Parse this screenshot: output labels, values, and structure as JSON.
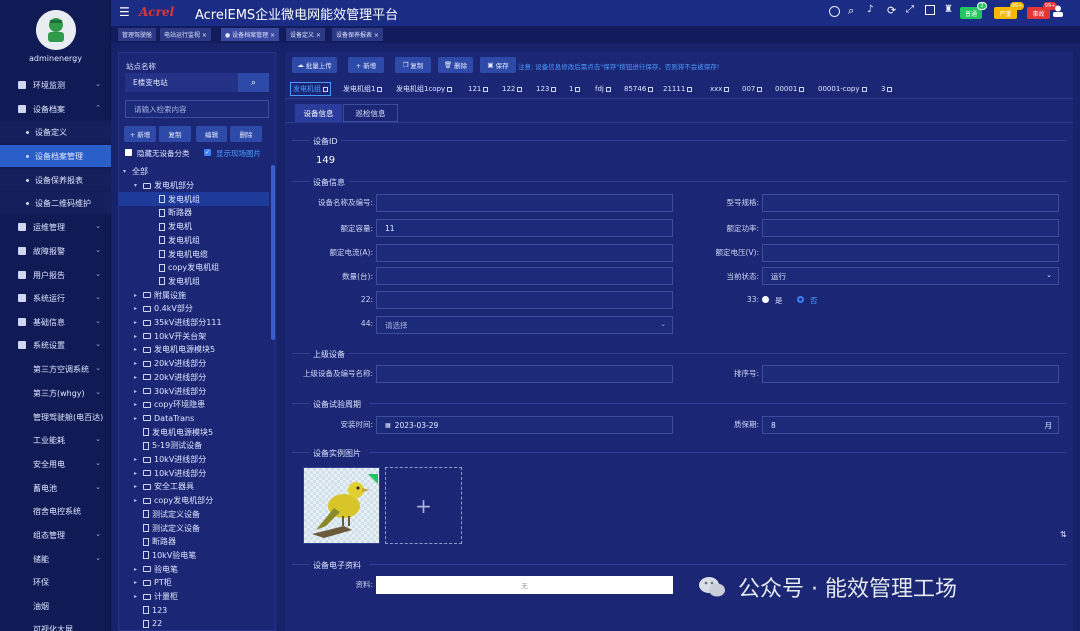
{
  "sidebar": {
    "username": "adminenergy",
    "items": [
      {
        "label": "环境监测"
      },
      {
        "label": "设备档案"
      },
      {
        "label": "设备定义"
      },
      {
        "label": "设备档案管理"
      },
      {
        "label": "设备保养报表"
      },
      {
        "label": "设备二维码维护"
      },
      {
        "label": "运维管理"
      },
      {
        "label": "故障报警"
      },
      {
        "label": "用户报告"
      },
      {
        "label": "系统运行"
      },
      {
        "label": "基础信息"
      },
      {
        "label": "系统设置"
      },
      {
        "label": "第三方空调系统"
      },
      {
        "label": "第三方(whgy)"
      },
      {
        "label": "管理驾驶舱(电百达)"
      },
      {
        "label": "工业能耗"
      },
      {
        "label": "安全用电"
      },
      {
        "label": "蓄电池"
      },
      {
        "label": "宿舍电控系统"
      },
      {
        "label": "组态管理"
      },
      {
        "label": "储能"
      },
      {
        "label": "环保"
      },
      {
        "label": "油烟"
      },
      {
        "label": "可视化大屏"
      }
    ]
  },
  "topbar": {
    "logo": "Acrel",
    "title": "AcrelEMS企业微电网能效管理平台",
    "badges": [
      {
        "label": "普通",
        "count": "2",
        "color": "#22c55e"
      },
      {
        "label": "严重",
        "count": "99+",
        "color": "#f5b800"
      },
      {
        "label": "事故",
        "count": "99+",
        "color": "#e53535"
      }
    ]
  },
  "tabs": [
    {
      "label": "管理驾驶舱"
    },
    {
      "label": "电站运行监视 ×"
    },
    {
      "label": "● 设备档案管理 ×"
    },
    {
      "label": "设备定义 ×"
    },
    {
      "label": "设备保养报表 ×"
    }
  ],
  "left": {
    "station_label": "站点名称",
    "station_value": "E楼变电站",
    "search_placeholder": "请输入检索内容",
    "buttons": {
      "add": "+ 新增",
      "copy": "复制",
      "edit": "编辑",
      "delete": "删除"
    },
    "hide_label": "隐藏无设备分类",
    "show_label": "显示现场图片",
    "tree": [
      {
        "label": "全部",
        "level": 0,
        "type": "root"
      },
      {
        "label": "发电机部分",
        "level": 1,
        "type": "folder-open"
      },
      {
        "label": "发电机组",
        "level": 2,
        "type": "file",
        "selected": true
      },
      {
        "label": "断路器",
        "level": 2,
        "type": "file"
      },
      {
        "label": "发电机",
        "level": 2,
        "type": "file"
      },
      {
        "label": "发电机组",
        "level": 2,
        "type": "file"
      },
      {
        "label": "发电机电缆",
        "level": 2,
        "type": "file"
      },
      {
        "label": "copy发电机组",
        "level": 2,
        "type": "file"
      },
      {
        "label": "发电机组",
        "level": 2,
        "type": "file"
      },
      {
        "label": "附属设施",
        "level": 1,
        "type": "folder"
      },
      {
        "label": "0.4kV部分",
        "level": 1,
        "type": "folder"
      },
      {
        "label": "35kV进线部分111",
        "level": 1,
        "type": "folder"
      },
      {
        "label": "10kV开关台架",
        "level": 1,
        "type": "folder"
      },
      {
        "label": "发电机电源模块5",
        "level": 1,
        "type": "folder"
      },
      {
        "label": "20kV进线部分",
        "level": 1,
        "type": "folder"
      },
      {
        "label": "20kV进线部分",
        "level": 1,
        "type": "folder"
      },
      {
        "label": "30kV进线部分",
        "level": 1,
        "type": "folder"
      },
      {
        "label": "copy环境隐患",
        "level": 1,
        "type": "folder"
      },
      {
        "label": "DataTrans",
        "level": 1,
        "type": "folder"
      },
      {
        "label": "发电机电源模块5",
        "level": 1,
        "type": "file"
      },
      {
        "label": "5-19测试设备",
        "level": 1,
        "type": "file"
      },
      {
        "label": "10kV进线部分",
        "level": 1,
        "type": "folder"
      },
      {
        "label": "10kV进线部分",
        "level": 1,
        "type": "folder"
      },
      {
        "label": "安全工器具",
        "level": 1,
        "type": "folder"
      },
      {
        "label": "copy发电机部分",
        "level": 1,
        "type": "folder"
      },
      {
        "label": "测试定义设备",
        "level": 1,
        "type": "file"
      },
      {
        "label": "测试定义设备",
        "level": 1,
        "type": "file"
      },
      {
        "label": "断路器",
        "level": 1,
        "type": "file"
      },
      {
        "label": "10kV验电笔",
        "level": 1,
        "type": "file"
      },
      {
        "label": "验电笔",
        "level": 1,
        "type": "folder"
      },
      {
        "label": "PT柜",
        "level": 1,
        "type": "folder"
      },
      {
        "label": "计量柜",
        "level": 1,
        "type": "folder"
      },
      {
        "label": "123",
        "level": 1,
        "type": "file"
      },
      {
        "label": "22",
        "level": 1,
        "type": "file"
      }
    ]
  },
  "toolbar": {
    "batch_upload": "批量上传",
    "add": "+ 新增",
    "copy": "复制",
    "delete": "删除",
    "save": "保存",
    "notice": "注意: 设备信息修改后需点击\"保存\"按钮进行保存，否则将不会被保存!"
  },
  "device_tabs": [
    "发电机组",
    "发电机组1",
    "发电机组1copy",
    "121",
    "122",
    "123",
    "1",
    "fdj",
    "85746",
    "21111",
    "xxx",
    "007",
    "00001",
    "00001-copy",
    "3"
  ],
  "subtabs": {
    "info": "设备信息",
    "inspection": "巡检信息"
  },
  "form": {
    "id_section": "设备ID",
    "id_value": "149",
    "info_section": "设备信息",
    "name_label": "设备名称及编号:",
    "name_value": "",
    "model_label": "型号规格:",
    "model_value": "",
    "cap_label": "额定容量:",
    "cap_value": "11",
    "power_label": "额定功率:",
    "power_value": "",
    "current_label": "额定电流(A):",
    "current_value": "",
    "voltage_label": "额定电压(V):",
    "voltage_value": "",
    "qty_label": "数量(台):",
    "qty_value": "",
    "status_label": "当前状态:",
    "status_value": "运行",
    "f22_label": "22:",
    "f22_value": "",
    "f33_label": "33:",
    "radio_yes": "是",
    "radio_no": "否",
    "f44_label": "44:",
    "f44_placeholder": "请选择",
    "parent_section": "上级设备",
    "parent_label": "上级设备及编号名称:",
    "parent_value": "",
    "sort_label": "排序号:",
    "sort_value": "",
    "trial_section": "设备试验周期",
    "install_label": "安装时间:",
    "install_value": "2023-03-29",
    "warranty_label": "质保期:",
    "warranty_value": "8",
    "warranty_unit": "月",
    "photo_section": "设备实例图片",
    "doc_section": "设备电子资料",
    "doc_label": "资料:",
    "doc_value": "无"
  },
  "watermark": "公众号 · 能效管理工场"
}
